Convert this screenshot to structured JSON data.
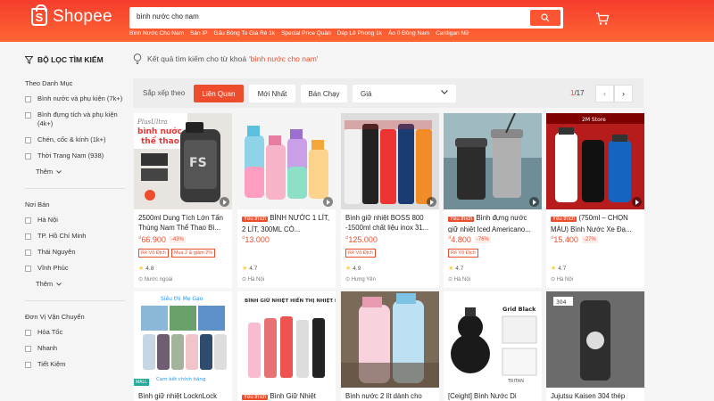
{
  "header": {
    "logo_text": "Shopee",
    "search_value": "bình nước cho nam",
    "suggestions": [
      "Bình Nước Cho Nam",
      "Sản IP",
      "Gấu Bông To Giá Rẻ 1k",
      "Special Price Quần",
      "Dép Lê Phong 1k",
      "Áo 0 Đồng Nam",
      "Cardigan Nữ"
    ]
  },
  "sidebar": {
    "title": "BỘ LỌC TÌM KIẾM",
    "category_title": "Theo Danh Mục",
    "categories": [
      "Bình nước và phụ kiện (7k+)",
      "Bình đựng tích và phụ kiện (4k+)",
      "Chén, cốc & kính (1k+)",
      "Thời Trang Nam (938)"
    ],
    "more_label": "Thêm",
    "location_title": "Nơi Bán",
    "locations": [
      "Hà Nội",
      "TP. Hồ Chí Minh",
      "Thái Nguyên",
      "Vĩnh Phúc"
    ],
    "more_label2": "Thêm",
    "shipping_title": "Đơn Vị Vận Chuyển",
    "shipping": [
      "Hỏa Tốc",
      "Nhanh",
      "Tiết Kiệm"
    ]
  },
  "result_note": {
    "prefix": "Kết quả tìm kiếm cho từ khoá",
    "keyword": "'bình nước cho nam'"
  },
  "sortbar": {
    "label": "Sắp xếp theo",
    "options": [
      "Liên Quan",
      "Mới Nhất",
      "Bán Chạy"
    ],
    "price_label": "Giá",
    "page_current": "1",
    "page_total": "/17"
  },
  "products": [
    {
      "title": "2500ml Dung Tích Lớn Tấn Thùng Nam Thể Thao Bì...",
      "currency": "₫",
      "price": "66.900",
      "discount": "-43%",
      "tags": [
        "Rẻ Vô Địch",
        "Mua 2 & giảm 2%"
      ],
      "rating": "4.8",
      "location": "Nước ngoài",
      "like": ""
    },
    {
      "title": "BÌNH NƯỚC 1 LÍT, 2 LÍT, 300ML CÓ...",
      "currency": "₫",
      "price": "13.000",
      "discount": "",
      "tags": [],
      "rating": "4.7",
      "location": "Hà Nội",
      "like": "Yêu thích"
    },
    {
      "title": "Bình giữ nhiệt BOSS 800 -1500ml chất liệu inox 31...",
      "currency": "₫",
      "price": "125.000",
      "discount": "",
      "tags": [
        "Rẻ Vô Địch"
      ],
      "rating": "4.9",
      "location": "Hưng Yên",
      "like": ""
    },
    {
      "title": "Bình đựng nước giữ nhiệt Iced Americano...",
      "currency": "₫",
      "price": "4.800",
      "discount": "-76%",
      "tags": [
        "Rẻ Vô Địch"
      ],
      "rating": "4.7",
      "location": "Hà Nội",
      "like": "Yêu thích"
    },
    {
      "title": "(750ml – CHỌN MÀU) Bình Nước Xe Đạ...",
      "currency": "₫",
      "price": "15.400",
      "discount": "-27%",
      "tags": [],
      "rating": "4.7",
      "location": "Hà Nội",
      "like": "Yêu thích"
    },
    {
      "title": "Bình giữ nhiệt LocknLock",
      "like": ""
    },
    {
      "title": "Bình Giữ Nhiệt",
      "like": "Yêu thích"
    },
    {
      "title": "Bình nước 2 lít dành cho",
      "like": ""
    },
    {
      "title": "[Ceight] Bình Nước Di",
      "like": ""
    },
    {
      "title": "Jujutsu Kaisen 304 thép",
      "like": ""
    }
  ],
  "image_text": {
    "p1_line1": "PlusUltra",
    "p1_line2": "bình nước",
    "p1_line3": "thể thao",
    "p5_store": "2M Store",
    "p6_top": "Siêu thị Mẹ Gạo",
    "p6_bottom": "Cam kết chính hãng",
    "p7_top": "BÌNH GIỮ NHIỆT HIỂN THỊ NHIỆT ĐỘ",
    "p9_label": "Grid Black",
    "p9_brand": "TRITAN",
    "p10_badge": "304"
  },
  "colors": {
    "brand": "#ee4d2d",
    "header_top": "#f53d2d",
    "header_bottom": "#ff6633"
  }
}
